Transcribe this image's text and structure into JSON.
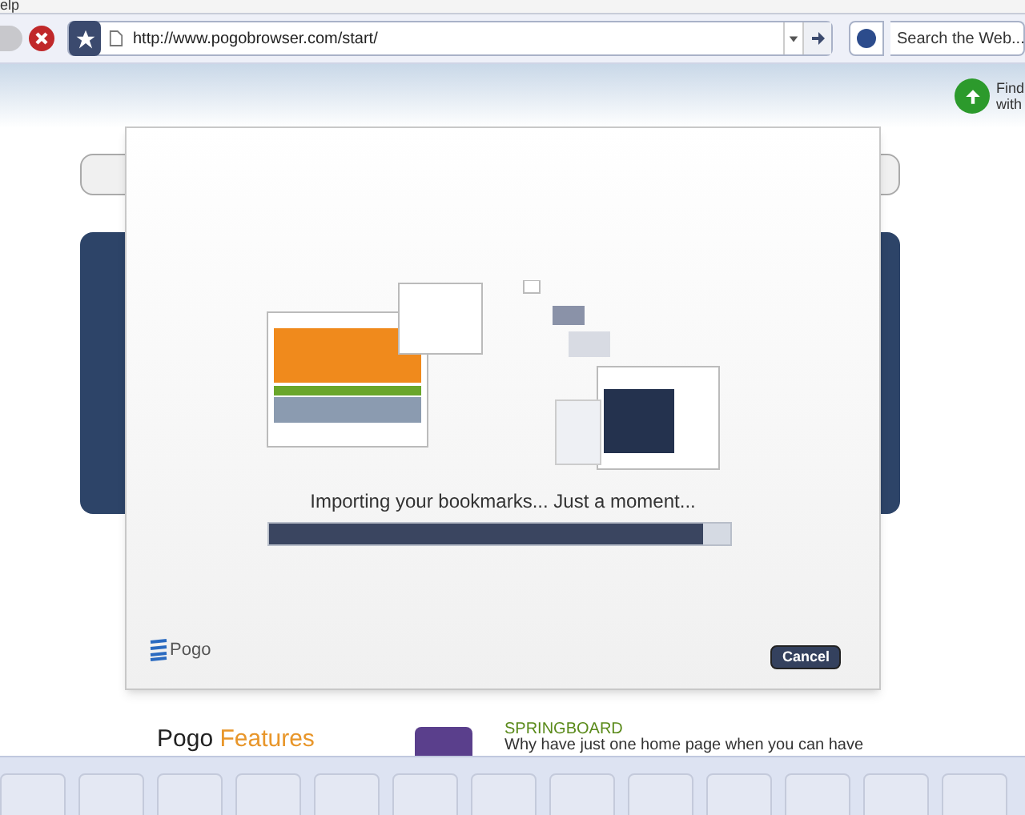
{
  "menu": {
    "items": [
      "elp"
    ]
  },
  "toolbar": {
    "address": "http://www.pogobrowser.com/start/",
    "search": {
      "placeholder": "Search the Web..."
    }
  },
  "header": {
    "find_text": [
      "Find",
      "with"
    ]
  },
  "dialog": {
    "status": "Importing your bookmarks... Just a moment...",
    "progress": {
      "level": 0.94
    },
    "logo": "Pogo",
    "cancel": "Cancel"
  },
  "features": {
    "title_1": "Pogo",
    "title_2": "Features",
    "item": {
      "title": "SPRINGBOARD",
      "text": "Why have just one home page when you can have"
    }
  }
}
